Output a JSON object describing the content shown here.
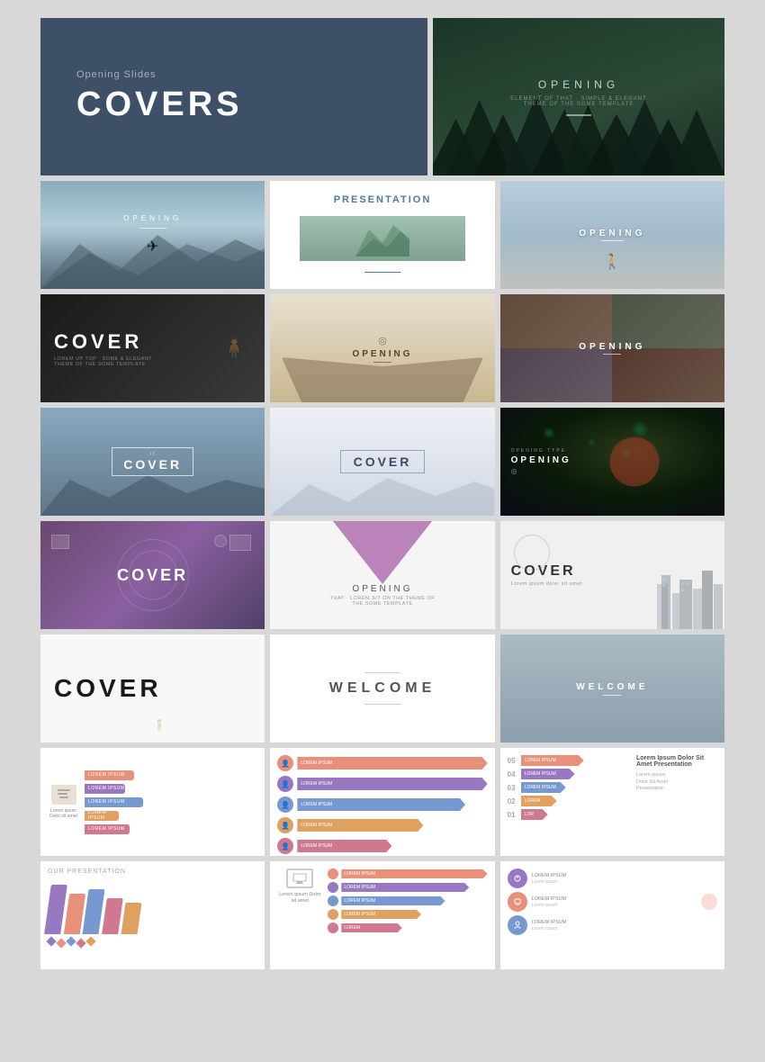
{
  "background": "#d8d8d8",
  "slides": {
    "row1": {
      "slide1": {
        "subtitle": "Opening Slides",
        "title": "COVERS",
        "bg": "#3d5068"
      },
      "slide2": {
        "label": "OPENING",
        "subtext": "ELEMENT OF THAT · SIMPLE & ELEGANT THEME OF THE SOME TEMPLATE",
        "bg": "forest-dark"
      }
    },
    "row2": {
      "slide1": {
        "label": "OPENING",
        "bg": "mountains"
      },
      "slide2": {
        "label": "PRESENTATION",
        "bg": "white"
      },
      "slide3": {
        "label": "OPENING",
        "bg": "lake"
      }
    },
    "row3": {
      "slide1": {
        "label": "COVER",
        "subtext": "LOREM UP TOP · SOME & ELEGANT THEME OF THE SOME TEMPLATE",
        "bg": "dark"
      },
      "slide2": {
        "label": "OPENING",
        "bg": "book"
      },
      "slide3": {
        "label": "OPENING",
        "bg": "collage"
      }
    },
    "row4": {
      "slide1": {
        "label": "COVER",
        "bg": "bluehill"
      },
      "slide2": {
        "label": "COVER",
        "bg": "coverwhite"
      },
      "slide3": {
        "label": "OPENING",
        "bg": "night"
      }
    },
    "row5": {
      "slide1": {
        "label": "COVER",
        "bg": "room"
      },
      "slide2": {
        "label": "OPENING",
        "sub": "THAT · LOREM SIT ON THE THEME OF THE SOME TEMPLATE",
        "bg": "flowers"
      },
      "slide3": {
        "label": "COVER",
        "bg": "city"
      }
    },
    "row6": {
      "slide1": {
        "label": "COVER",
        "bg": "cover-white"
      },
      "slide2": {
        "label": "WELCOME",
        "bg": "welcome"
      },
      "slide3": {
        "label": "WELCOME",
        "bg": "welcome-photo"
      }
    },
    "row7": {
      "slide1": {
        "type": "infographic1"
      },
      "slide2": {
        "type": "infographic2"
      },
      "slide3": {
        "type": "infographic3"
      }
    },
    "row8": {
      "slide1": {
        "type": "infographic4"
      },
      "slide2": {
        "type": "infographic5"
      },
      "slide3": {
        "type": "infographic6"
      }
    }
  },
  "labels": {
    "covers": "COVERS",
    "opening": "OPENING",
    "opening_slides": "Opening Slides",
    "presentation": "PRESENTATION",
    "cover": "COVER",
    "welcome": "WELCOME",
    "lorem_ipsum": "Lorem Ipsum\nDolor Sit Amet",
    "lorem_ipsum2": "Lorem Ipsum\nDolor Sit Amet\nPresentation",
    "our_presentation": "OUR PRESENTATION",
    "lorem_ipsum_short": "Lorem ipsum\nDolor sit amet"
  },
  "bar_data": [
    {
      "label": "LOREM IPSUM",
      "width": 80,
      "color": "salmon"
    },
    {
      "label": "LOREM IPSUM",
      "width": 60,
      "color": "purple"
    },
    {
      "label": "LOREM IPSUM",
      "width": 90,
      "color": "blue"
    },
    {
      "label": "LOREM IPSUM",
      "width": 50,
      "color": "orange"
    },
    {
      "label": "LOREM IPSUM",
      "width": 70,
      "color": "pink"
    }
  ],
  "arrow_data": [
    {
      "num": "01",
      "label": "LOREM IPSUM",
      "width": 95,
      "color": "#e8907a"
    },
    {
      "num": "02",
      "label": "LOREM IPSUM",
      "width": 80,
      "color": "#9878c0"
    },
    {
      "num": "03",
      "label": "LOREM IPSUM",
      "width": 65,
      "color": "#7898d0"
    },
    {
      "num": "04",
      "label": "LOREM IPSUM",
      "width": 50,
      "color": "#e0a060"
    },
    {
      "num": "05",
      "label": "LOREM IPSUM",
      "width": 35,
      "color": "#d07890"
    }
  ]
}
